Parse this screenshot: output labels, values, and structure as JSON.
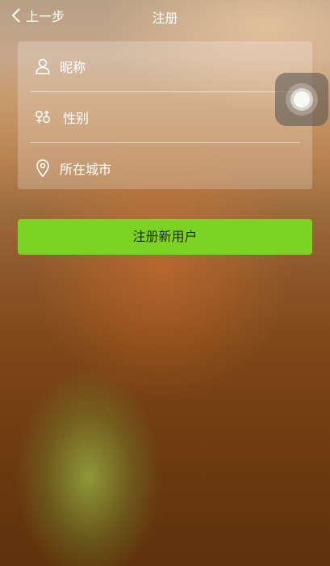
{
  "header": {
    "back_label": "上一步",
    "title": "注册"
  },
  "form": {
    "fields": [
      {
        "icon": "user-icon",
        "label": "昵称"
      },
      {
        "icon": "gender-icon",
        "label": "性别"
      },
      {
        "icon": "location-pin-icon",
        "label": "所在城市"
      }
    ]
  },
  "submit": {
    "label": "注册新用户"
  },
  "colors": {
    "submit_bg": "#7cd321",
    "text": "#ffffff"
  }
}
